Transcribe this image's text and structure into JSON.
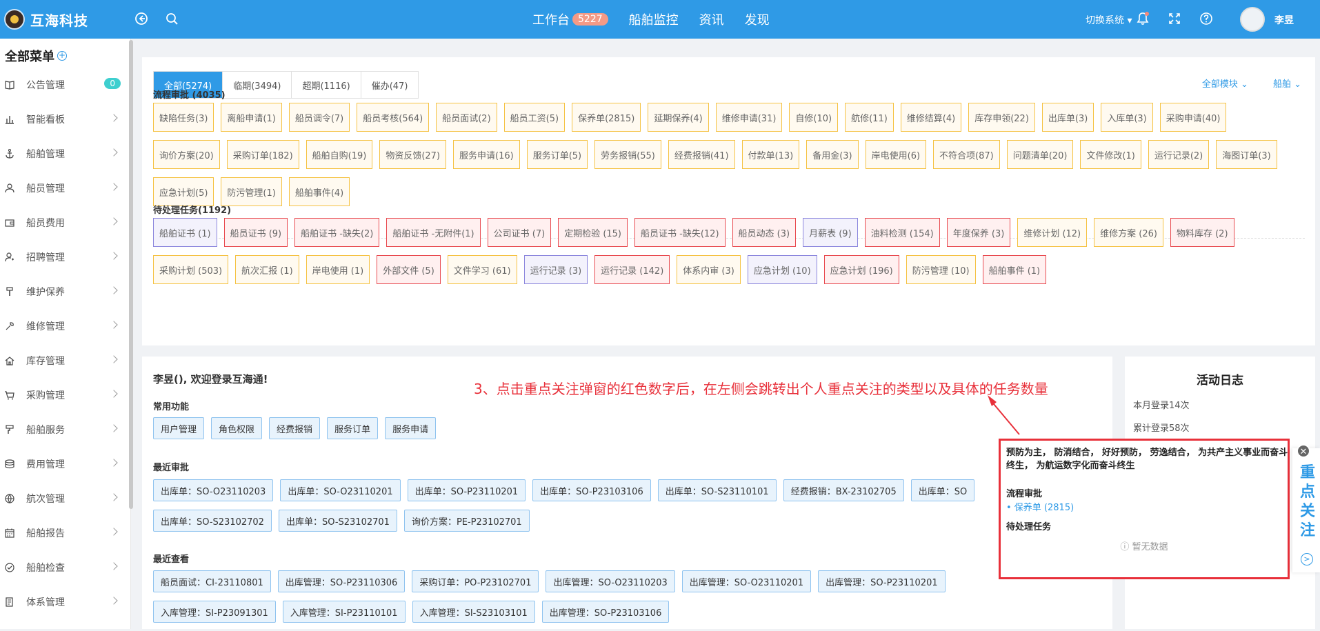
{
  "header": {
    "brand": "互海科技",
    "nav": [
      {
        "label": "工作台",
        "badge": "5227"
      },
      {
        "label": "船舶监控"
      },
      {
        "label": "资讯"
      },
      {
        "label": "发现"
      }
    ],
    "switch_system": "切换系统",
    "user": "李昱",
    "icons": [
      "back-icon",
      "search-icon",
      "bell-icon",
      "fullscreen-icon",
      "help-icon",
      "chevron-down-icon"
    ]
  },
  "sidebar": {
    "title": "全部菜单",
    "items": [
      {
        "label": "公告管理",
        "badge": "0",
        "icon": "book-icon"
      },
      {
        "label": "智能看板",
        "icon": "bar-chart-icon"
      },
      {
        "label": "船舶管理",
        "icon": "anchor-icon"
      },
      {
        "label": "船员管理",
        "icon": "user-icon"
      },
      {
        "label": "船员费用",
        "icon": "wallet-icon"
      },
      {
        "label": "招聘管理",
        "icon": "recruit-icon"
      },
      {
        "label": "维护保养",
        "icon": "tool-icon"
      },
      {
        "label": "维修管理",
        "icon": "wrench-icon"
      },
      {
        "label": "库存管理",
        "icon": "home-icon"
      },
      {
        "label": "采购管理",
        "icon": "cart-icon"
      },
      {
        "label": "船舶服务",
        "icon": "brush-icon"
      },
      {
        "label": "费用管理",
        "icon": "coins-icon"
      },
      {
        "label": "航次管理",
        "icon": "globe-icon"
      },
      {
        "label": "船舶报告",
        "icon": "calendar-icon"
      },
      {
        "label": "船舶检查",
        "icon": "check-circle-icon"
      },
      {
        "label": "体系管理",
        "icon": "doc-icon"
      }
    ]
  },
  "tabs": [
    {
      "label": "全部(5274)",
      "active": true
    },
    {
      "label": "临期(3494)"
    },
    {
      "label": "超期(1116)"
    },
    {
      "label": "催办(47)"
    }
  ],
  "filters": [
    "全部模块",
    "船舶"
  ],
  "process": {
    "title": "流程审批 (4035)",
    "chips": [
      "缺陷任务(3)",
      "离船申请(1)",
      "船员调令(7)",
      "船员考核(564)",
      "船员面试(2)",
      "船员工资(5)",
      "保养单(2815)",
      "延期保养(4)",
      "维修申请(31)",
      "自修(10)",
      "航修(11)",
      "维修结算(4)",
      "库存申领(22)",
      "出库单(3)",
      "入库单(3)",
      "采购申请(40)",
      "询价方案(20)",
      "采购订单(182)",
      "船舶自购(19)",
      "物资反馈(27)",
      "服务申请(16)",
      "服务订单(5)",
      "劳务报销(55)",
      "经费报销(41)",
      "付款单(13)",
      "备用金(3)",
      "岸电使用(6)",
      "不符合项(87)",
      "问题清单(20)",
      "文件修改(1)",
      "运行记录(2)",
      "海图订单(3)",
      "应急计划(5)",
      "防污管理(1)",
      "船舶事件(4)"
    ]
  },
  "pending": {
    "title": "待处理任务(1192)",
    "chips": [
      {
        "label": "船舶证书 (1)",
        "t": "purple"
      },
      {
        "label": "船员证书 (9)",
        "t": "red"
      },
      {
        "label": "船舶证书 -缺失(2)",
        "t": "red"
      },
      {
        "label": "船舶证书 -无附件(1)",
        "t": "red"
      },
      {
        "label": "公司证书 (7)",
        "t": "red"
      },
      {
        "label": "定期检验 (15)",
        "t": "red"
      },
      {
        "label": "船员证书 -缺失(12)",
        "t": "red"
      },
      {
        "label": "船员动态 (3)",
        "t": "red"
      },
      {
        "label": "月薪表 (9)",
        "t": "purple"
      },
      {
        "label": "油料检测 (154)",
        "t": "red"
      },
      {
        "label": "年度保养 (3)",
        "t": "red"
      },
      {
        "label": "维修计划 (12)",
        "t": "yellow"
      },
      {
        "label": "维修方案 (26)",
        "t": "yellow"
      },
      {
        "label": "物料库存 (2)",
        "t": "red"
      },
      {
        "label": "采购计划 (503)",
        "t": "yellow"
      },
      {
        "label": "航次汇报 (1)",
        "t": "yellow"
      },
      {
        "label": "岸电使用 (1)",
        "t": "yellow"
      },
      {
        "label": "外部文件 (5)",
        "t": "red"
      },
      {
        "label": "文件学习 (61)",
        "t": "yellow"
      },
      {
        "label": "运行记录 (3)",
        "t": "purple"
      },
      {
        "label": "运行记录 (142)",
        "t": "red"
      },
      {
        "label": "体系内审 (3)",
        "t": "yellow"
      },
      {
        "label": "应急计划 (10)",
        "t": "purple"
      },
      {
        "label": "应急计划 (196)",
        "t": "red"
      },
      {
        "label": "防污管理 (10)",
        "t": "yellow"
      },
      {
        "label": "船舶事件 (1)",
        "t": "red"
      }
    ]
  },
  "welcome": {
    "title": "李昱(), 欢迎登录互海通!",
    "common_label": "常用功能",
    "common": [
      "用户管理",
      "角色权限",
      "经费报销",
      "服务订单",
      "服务申请"
    ],
    "recent_approval_label": "最近审批",
    "recent_approval": [
      "出库单：SO-O23110203",
      "出库单：SO-O23110201",
      "出库单：SO-P23110201",
      "出库单：SO-P23103106",
      "出库单：SO-S23110101",
      "经费报销：BX-23102705",
      "出库单：SO",
      "出库单：SO-S23102702",
      "出库单：SO-S23102701",
      "询价方案：PE-P23102701"
    ],
    "recent_view_label": "最近查看",
    "recent_view": [
      "船员面试：CI-23110801",
      "出库管理：SO-P23110306",
      "采购订单：PO-P23102701",
      "出库管理：SO-O23110203",
      "出库管理：SO-O23110201",
      "出库管理：SO-P23110201",
      "入库管理：SI-P23091301",
      "入库管理：SI-P23110101",
      "入库管理：SI-S23103101",
      "出库管理：SO-P23103106"
    ]
  },
  "annotation": "3、点击重点关注弹窗的红色数字后，在左侧会跳转出个人重点关注的类型以及具体的任务数量",
  "activity": {
    "title": "活动日志",
    "rows": [
      "本月登录14次",
      "累计登录58次"
    ]
  },
  "popup": {
    "motto": "预防为主， 防消结合， 好好预防， 劳逸结合， 为共产主义事业而奋斗终生， 为航运数字化而奋斗终生",
    "process_title": "流程审批",
    "process_item": "• 保养单 (2815)",
    "pending_title": "待处理任务",
    "empty": "ⓘ 暂无数据"
  },
  "focus": {
    "label": "重点关注",
    "close": "✕",
    "next": ">"
  }
}
